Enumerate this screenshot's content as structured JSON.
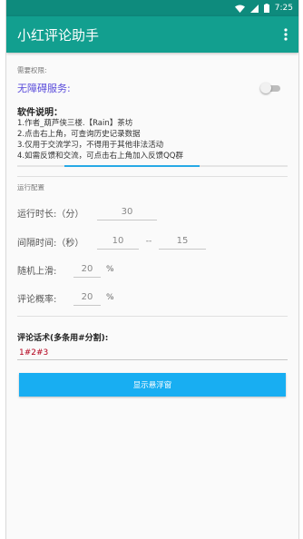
{
  "status_bar": {
    "time": "7:25"
  },
  "app_bar": {
    "title": "小红评论助手",
    "menu_icon": "more-vert-icon"
  },
  "permissions": {
    "section_label": "需要权限:",
    "accessibility_label": "无障碍服务:",
    "accessibility_enabled": false
  },
  "description": {
    "title": "软件说明：",
    "lines": [
      "1.作者_葫芦侠三楼.【Rain】茶坊",
      "2.点击右上角，可查询历史记录数据",
      "3.仅用于交流学习，不得用于其他非法活动",
      "4.如需反馈和交流，可点击右上角加入反馈QQ群"
    ],
    "scroll_position": 0.35
  },
  "run_config": {
    "section_label": "运行配置",
    "duration": {
      "label": "运行时长:（分）",
      "value": "30"
    },
    "interval": {
      "label": "间隔时间:（秒）",
      "min": "10",
      "separator": "--",
      "max": "15"
    },
    "random_slide": {
      "label": "随机上滑:",
      "value": "20",
      "unit": "%"
    },
    "comment_rate": {
      "label": "评论概率:",
      "value": "20",
      "unit": "%"
    }
  },
  "comments": {
    "label": "评论话术(多条用#分割):",
    "value": "1#2#3"
  },
  "float_button": {
    "label": "显示悬浮窗"
  },
  "colors": {
    "status_bar": "#0e8b7d",
    "app_bar": "#129f8f",
    "accent_blue": "#18aef2",
    "accessibility_label": "#5a4cdb",
    "comment_text": "#b3001b"
  }
}
